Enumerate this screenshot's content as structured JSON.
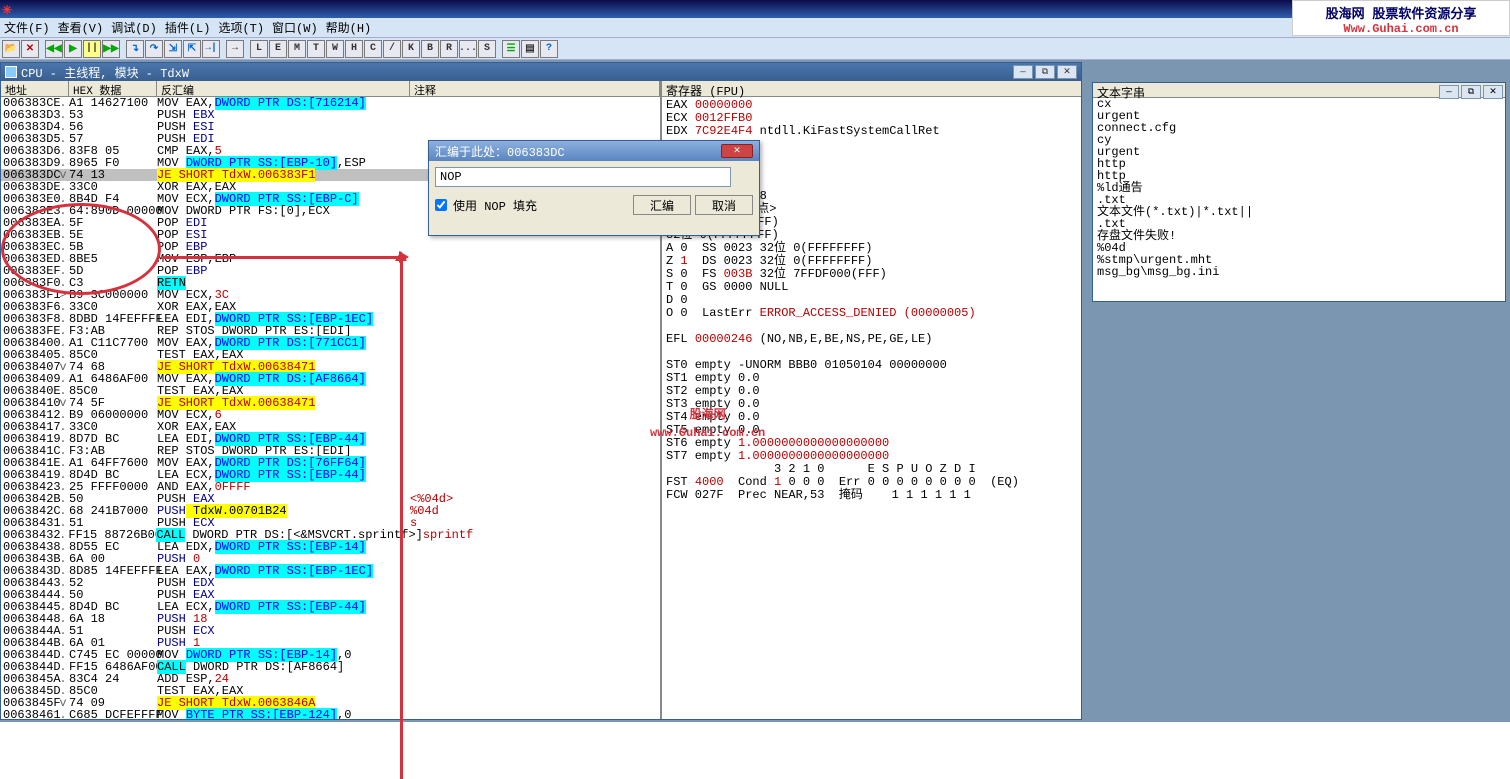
{
  "menu": {
    "file": "文件(F)",
    "view": "查看(V)",
    "debug": "调试(D)",
    "plugin": "插件(L)",
    "options": "选项(T)",
    "window": "窗口(W)",
    "help": "帮助(H)"
  },
  "toolbar_letters": [
    "L",
    "E",
    "M",
    "T",
    "W",
    "H",
    "C",
    "/",
    "K",
    "B",
    "R",
    "...",
    "S"
  ],
  "cpu_title": "CPU - 主线程, 模块 - TdxW",
  "cols": {
    "addr": "地址",
    "hex": "HEX 数据",
    "asm": "反汇编",
    "cmt": "注释"
  },
  "rows": [
    {
      "a": "006383CE",
      "e": ".",
      "h": "A1 14627100",
      "m": "MOV EAX,",
      "op": "DWORD PTR DS:[716214]",
      "ot": "blue"
    },
    {
      "a": "006383D3",
      "e": ".",
      "h": "53",
      "m": "PUSH",
      "op": " EBX",
      "ot": "pp"
    },
    {
      "a": "006383D4",
      "e": ".",
      "h": "56",
      "m": "PUSH",
      "op": " ESI",
      "ot": "pp"
    },
    {
      "a": "006383D5",
      "e": ".",
      "h": "57",
      "m": "PUSH",
      "op": " EDI",
      "ot": "pp"
    },
    {
      "a": "006383D6",
      "e": ".",
      "h": "83F8 05",
      "m": "CMP EAX,",
      "op": "5",
      "ot": "r"
    },
    {
      "a": "006383D9",
      "e": ".",
      "h": "8965 F0",
      "m": "MOV ",
      "op": "DWORD PTR SS:[EBP-10]",
      "tail": ",ESP",
      "ot": "blue"
    },
    {
      "a": "006383DC",
      "e": "v",
      "h": "74 13",
      "je": "JE SHORT TdxW.006383F1",
      "sel": true
    },
    {
      "a": "006383DE",
      "e": ".",
      "h": "33C0",
      "m": "XOR EAX,EAX"
    },
    {
      "a": "006383E0",
      "e": ".",
      "h": "8B4D F4",
      "m": "MOV ECX,",
      "op": "DWORD PTR SS:[EBP-C]",
      "ot": "blue"
    },
    {
      "a": "006383E3",
      "e": ".",
      "h": "64:890D 00000",
      "m": "MOV DWORD PTR FS:[0],ECX"
    },
    {
      "a": "006383EA",
      "e": ".",
      "h": "5F",
      "m": "POP",
      "op": " EDI",
      "ot": "pp"
    },
    {
      "a": "006383EB",
      "e": ".",
      "h": "5E",
      "m": "POP",
      "op": " ESI",
      "ot": "pp"
    },
    {
      "a": "006383EC",
      "e": ".",
      "h": "5B",
      "m": "POP",
      "op": " EBP",
      "ot": "pp"
    },
    {
      "a": "006383ED",
      "e": ".",
      "h": "8BE5",
      "m": "MOV ESP,EBP"
    },
    {
      "a": "006383EF",
      "e": ".",
      "h": "5D",
      "m": "POP",
      "op": " EBP",
      "ot": "pp"
    },
    {
      "a": "006383F0",
      "e": ".",
      "h": "C3",
      "retn": "RETN"
    },
    {
      "a": "006383F1",
      "e": ">",
      "h": "B9 3C000000",
      "m": "MOV ECX,",
      "op": "3C",
      "ot": "r"
    },
    {
      "a": "006383F6",
      "e": ".",
      "h": "33C0",
      "m": "XOR EAX,EAX"
    },
    {
      "a": "006383F8",
      "e": ".",
      "h": "8DBD 14FEFFFF",
      "m": "LEA EDI,",
      "op": "DWORD PTR SS:[EBP-1EC]",
      "ot": "blue"
    },
    {
      "a": "006383FE",
      "e": ".",
      "h": "F3:AB",
      "m": "REP STOS DWORD PTR ES:[EDI]"
    },
    {
      "a": "00638400",
      "e": ".",
      "h": "A1 C11C7700",
      "m": "MOV EAX,",
      "op": "DWORD PTR DS:[771CC1]",
      "ot": "blue"
    },
    {
      "a": "00638405",
      "e": ".",
      "h": "85C0",
      "m": "TEST EAX,EAX"
    },
    {
      "a": "00638407",
      "e": "v",
      "h": "74 68",
      "je": "JE SHORT TdxW.00638471"
    },
    {
      "a": "00638409",
      "e": ".",
      "h": "A1 6486AF00",
      "m": "MOV EAX,",
      "op": "DWORD PTR DS:[AF8664]",
      "ot": "blue"
    },
    {
      "a": "0063840E",
      "e": ".",
      "h": "85C0",
      "m": "TEST EAX,EAX"
    },
    {
      "a": "00638410",
      "e": "v",
      "h": "74 5F",
      "je": "JE SHORT TdxW.00638471"
    },
    {
      "a": "00638412",
      "e": ".",
      "h": "B9 06000000",
      "m": "MOV ECX,",
      "op": "6",
      "ot": "r"
    },
    {
      "a": "00638417",
      "e": ".",
      "h": "33C0",
      "m": "XOR EAX,EAX"
    },
    {
      "a": "00638419",
      "e": ".",
      "h": "8D7D BC",
      "m": "LEA EDI,",
      "op": "DWORD PTR SS:[EBP-44]",
      "ot": "blue"
    },
    {
      "a": "0063841C",
      "e": ".",
      "h": "F3:AB",
      "m": "REP STOS DWORD PTR ES:[EDI]"
    },
    {
      "a": "0063841E",
      "e": ".",
      "h": "A1 64FF7600",
      "m": "MOV EAX,",
      "op": "DWORD PTR DS:[76FF64]",
      "ot": "blue"
    },
    {
      "a": "00638419",
      "e": ".",
      "h": "8D4D BC",
      "m": "LEA ECX,",
      "op": "DWORD PTR SS:[EBP-44]",
      "ot": "blue"
    },
    {
      "a": "00638423",
      "e": ".",
      "h": "25 FFFF0000",
      "m": "AND EAX,",
      "op": "0FFFF",
      "ot": "r"
    },
    {
      "a": "0063842B",
      "e": ".",
      "h": "50",
      "m": "PUSH",
      "op": " EAX",
      "ot": "pp",
      "c": "<%04d>"
    },
    {
      "a": "0063842C",
      "e": ".",
      "h": "68 241B7000",
      "m": "PUSH",
      "op": " TdxW.00701B24",
      "ot": "ppy",
      "c": "%04d"
    },
    {
      "a": "00638431",
      "e": ".",
      "h": "51",
      "m": "PUSH",
      "op": " ECX",
      "ot": "pp",
      "c": "s"
    },
    {
      "a": "00638432",
      "e": ".",
      "h": "FF15 88726B00",
      "call": "CALL",
      "tail": " DWORD PTR DS:[<&MSVCRT.sprintf>]",
      "c": "sprintf"
    },
    {
      "a": "00638438",
      "e": ".",
      "h": "8D55 EC",
      "m": "LEA EDX,",
      "op": "DWORD PTR SS:[EBP-14]",
      "ot": "blue"
    },
    {
      "a": "0063843B",
      "e": ".",
      "h": "6A 00",
      "m": "PUSH",
      "op": " 0",
      "ot": "ppr"
    },
    {
      "a": "0063843D",
      "e": ".",
      "h": "8D85 14FEFFFF",
      "m": "LEA EAX,",
      "op": "DWORD PTR SS:[EBP-1EC]",
      "ot": "blue"
    },
    {
      "a": "00638443",
      "e": ".",
      "h": "52",
      "m": "PUSH",
      "op": " EDX",
      "ot": "pp"
    },
    {
      "a": "00638444",
      "e": ".",
      "h": "50",
      "m": "PUSH",
      "op": " EAX",
      "ot": "pp"
    },
    {
      "a": "00638445",
      "e": ".",
      "h": "8D4D BC",
      "m": "LEA ECX,",
      "op": "DWORD PTR SS:[EBP-44]",
      "ot": "blue"
    },
    {
      "a": "00638448",
      "e": ".",
      "h": "6A 18",
      "m": "PUSH",
      "op": " 18",
      "ot": "ppr"
    },
    {
      "a": "0063844A",
      "e": ".",
      "h": "51",
      "m": "PUSH",
      "op": " ECX",
      "ot": "pp"
    },
    {
      "a": "0063844B",
      "e": ".",
      "h": "6A 01",
      "m": "PUSH",
      "op": " 1",
      "ot": "ppr"
    },
    {
      "a": "0063844D",
      "e": ".",
      "h": "C745 EC 00000",
      "m": "MOV ",
      "op": "DWORD PTR SS:[EBP-14]",
      "tail": ",0",
      "ot": "blue"
    },
    {
      "a": "0063844D",
      "e": ".",
      "h": "FF15 6486AF00",
      "call": "CALL",
      "tail": " DWORD PTR DS:[AF8664]"
    },
    {
      "a": "0063845A",
      "e": ".",
      "h": "83C4 24",
      "m": "ADD ESP,",
      "op": "24",
      "ot": "r"
    },
    {
      "a": "0063845D",
      "e": ".",
      "h": "85C0",
      "m": "TEST EAX,EAX"
    },
    {
      "a": "0063845F",
      "e": "v",
      "h": "74 09",
      "je": "JE SHORT TdxW.0063846A"
    },
    {
      "a": "00638461",
      "e": ".",
      "h": "C685 DCFEFFFF",
      "m": "MOV ",
      "op": "BYTE PTR SS:[EBP-124]",
      "tail": ",0",
      "ot": "blue"
    }
  ],
  "regs": {
    "title": "寄存器 (FPU)",
    "lines": [
      "EAX <r>00000000</r>",
      "ECX <r>0012FFB0</r>",
      "EDX <r>7C92E4F4</r> ntdll.KiFastSystemCallRet",
      "",
      "",
      "",
      "",
      "ntdll.7C930208",
      "TdxW.<模块入口点>",
      "32位 0(FFFFFFFF)",
      "32位 0(FFFFFFFF)",
      "A 0  SS 0023 32位 0(FFFFFFFF)",
      "Z <r>1</r>  DS 0023 32位 0(FFFFFFFF)",
      "S 0  FS <r>003B</r> 32位 7FFDF000(FFF)",
      "T 0  GS 0000 NULL",
      "D 0",
      "O 0  LastErr <r>ERROR_ACCESS_DENIED (00000005)</r>",
      "",
      "EFL <r>00000246</r> (NO,NB,E,BE,NS,PE,GE,LE)",
      "",
      "ST0 empty -UNORM BBB0 01050104 00000000",
      "ST1 empty 0.0",
      "ST2 empty 0.0",
      "ST3 empty 0.0",
      "ST4 empty 0.0",
      "ST5 empty 0.0",
      "ST6 empty <r>1.0000000000000000000</r>",
      "ST7 empty <r>1.0000000000000000000</r>",
      "               3 2 1 0      E S P U O Z D I",
      "FST <r>4000</r>  Cond <r>1</r> 0 0 0  Err 0 0 0 0 0 0 0 0  (EQ)",
      "FCW 027F  Prec NEAR,53  掩码    1 1 1 1 1 1"
    ]
  },
  "strings": {
    "title": "文本字串",
    "items": [
      "cx",
      "urgent",
      "connect.cfg",
      "cy",
      "urgent",
      "http",
      "http",
      "%ld通告",
      ".txt",
      "文本文件(*.txt)|*.txt||",
      "",
      ".txt",
      "存盘文件失败!",
      "%04d",
      "%stmp\\urgent.mht",
      "msg_bg\\msg_bg.ini"
    ]
  },
  "dialog": {
    "title": "汇编于此处：006383DC",
    "input": "NOP",
    "chk": "使用 NOP 填充",
    "ok": "汇编",
    "cancel": "取消"
  },
  "watermark": {
    "l1": "股海网",
    "l2": "www.Guhai.com.cn"
  },
  "logo": {
    "l1": "股海网 股票软件资源分享",
    "l2": "Www.Guhai.com.cn"
  }
}
